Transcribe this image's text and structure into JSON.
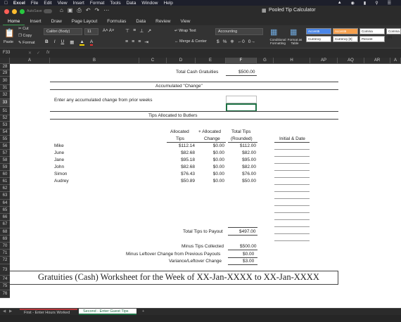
{
  "menubar": {
    "app": "Excel",
    "items": [
      "File",
      "Edit",
      "View",
      "Insert",
      "Format",
      "Tools",
      "Data",
      "Window",
      "Help"
    ]
  },
  "window": {
    "title": "Pooled Tip Calculator",
    "autosave": "AutoSave"
  },
  "ribbon_tabs": [
    "Home",
    "Insert",
    "Draw",
    "Page Layout",
    "Formulas",
    "Data",
    "Review",
    "View"
  ],
  "ribbon": {
    "paste": "Paste",
    "cut": "Cut",
    "copy": "Copy",
    "format": "Format",
    "font": "Calibri (Body)",
    "size": "11",
    "wrap": "Wrap Text",
    "merge": "Merge & Center",
    "number_format": "Accounting",
    "dollar": "$",
    "pct": "%",
    "cond": "Conditional Formatting",
    "format_table": "Format as Table",
    "styles": [
      "Accent5",
      "Accent6",
      "Comma",
      "Comma [0]",
      "Currency",
      "Currency [0]",
      "Percent"
    ]
  },
  "formula_bar": {
    "cell_ref": "F33",
    "fx": "fx",
    "value": ""
  },
  "columns": [
    "A",
    "B",
    "C",
    "D",
    "E",
    "F",
    "G",
    "H",
    "AP",
    "AQ",
    "AR",
    "A"
  ],
  "rows": [
    "28",
    "29",
    "30",
    "31",
    "32",
    "33",
    "51",
    "52",
    "53",
    "54",
    "55",
    "56",
    "57",
    "58",
    "59",
    "60",
    "61",
    "62",
    "63",
    "64",
    "65",
    "66",
    "67",
    "68",
    "69",
    "70",
    "71",
    "72",
    "73",
    "74",
    "75",
    "76"
  ],
  "sheet": {
    "total_cash_label": "Total Cash Gratuities",
    "total_cash_value": "$500.00",
    "accumulated_header": "Accumulated \"Change\"",
    "enter_change": "Enter any accumulated change from prior weeks",
    "tips_header": "Tips Allocated to Butlers",
    "col_alloc": [
      "Allocated",
      "Tips"
    ],
    "col_plus": [
      "+ Allocated",
      "Change"
    ],
    "col_total": [
      "Total Tips",
      "(Rounded)"
    ],
    "col_initial": "Initial & Date",
    "names": [
      "Mike",
      "June",
      "Jane",
      "John",
      "Simon",
      "Audrey"
    ],
    "alloc": [
      "$112.14",
      "$82.68",
      "$95.18",
      "$82.68",
      "$76.43",
      "$50.89"
    ],
    "change": [
      "$0.00",
      "$0.00",
      "$0.00",
      "$0.00",
      "$0.00",
      "$0.00"
    ],
    "total": [
      "$112.00",
      "$82.00",
      "$95.00",
      "$82.00",
      "$76.00",
      "$50.00"
    ],
    "total_payout_label": "Total Tips to Payout",
    "total_payout_value": "$497.00",
    "minus_collected_label": "Minus Tips Collected",
    "minus_collected_value": "$500.00",
    "minus_leftover_label": "Minus Leftover Change from Previous Payouts",
    "minus_leftover_value": "$0.00",
    "variance_label": "Variance/Leftover Change",
    "variance_value": "$3.00",
    "banner": "Gratuities (Cash) Worksheet for the Week of XX-Jan-XXXX to XX-Jan-XXXX"
  },
  "sheet_tabs": [
    "First - Enter Hours Worked",
    "Second - Enter Guest Tips",
    "+"
  ]
}
